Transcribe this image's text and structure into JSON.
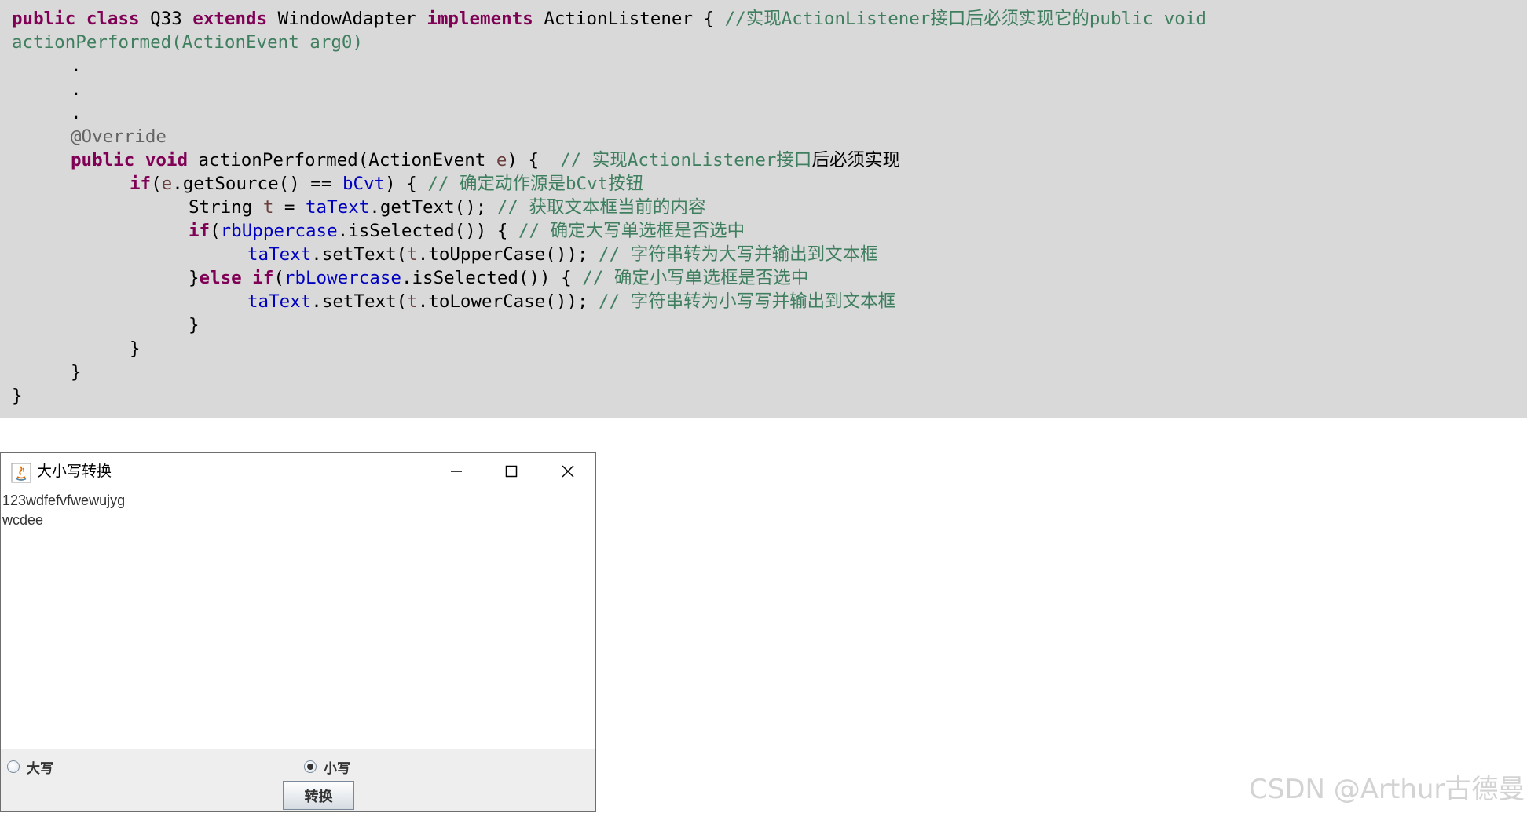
{
  "code": {
    "l1": {
      "kw1": "public class",
      "t1": " Q33 ",
      "kw2": "extends",
      "t2": " WindowAdapter ",
      "kw3": "implements",
      "t3": " ActionListener { ",
      "c": "//实现ActionListener接口后必须实现它的public void"
    },
    "l2": {
      "c": "actionPerformed(ActionEvent arg0)"
    },
    "l3": {
      "t": "."
    },
    "l4": {
      "t": "."
    },
    "l5": {
      "t": "."
    },
    "l6": {
      "ann": "@Override"
    },
    "l7": {
      "kw": "public void",
      "t1": " actionPerformed(ActionEvent ",
      "v": "e",
      "t2": ") {  ",
      "c": "// 实现ActionListener接口",
      "t3": "后必须实现"
    },
    "l8": {
      "kw": "if",
      "t1": "(",
      "v": "e",
      "t2": ".getSource() == ",
      "f": "bCvt",
      "t3": ") { ",
      "c": "// 确定动作源是bCvt按钮"
    },
    "l9": {
      "t1": "String ",
      "v": "t",
      "t2": " = ",
      "f": "taText",
      "t3": ".getText(); ",
      "c": "// 获取文本框当前的内容"
    },
    "l10": {
      "kw": "if",
      "t1": "(",
      "f": "rbUppercase",
      "t2": ".isSelected()) { ",
      "c": "// 确定大写单选框是否选中"
    },
    "l11": {
      "f": "taText",
      "t1": ".setText(",
      "v": "t",
      "t2": ".toUpperCase()); ",
      "c": "// 字符串转为大写并输出到文本框"
    },
    "l12": {
      "t1": "}",
      "kw": "else if",
      "t2": "(",
      "f": "rbLowercase",
      "t3": ".isSelected()) { ",
      "c": "// 确定小写单选框是否选中"
    },
    "l13": {
      "f": "taText",
      "t1": ".setText(",
      "v": "t",
      "t2": ".toLowerCase()); ",
      "c": "// 字符串转为小写写并输出到文本框"
    },
    "l14": {
      "t": "}"
    },
    "l15": {
      "t": "}"
    },
    "l16": {
      "t": "}"
    },
    "l17": {
      "t": "}"
    }
  },
  "window": {
    "title": "大小写转换",
    "icon": "java-icon",
    "text_lines": [
      "123wdfefvfwewujyg",
      "wcdee"
    ],
    "radio_upper_label": "大写",
    "radio_lower_label": "小写",
    "selected_radio": "小写",
    "convert_label": "转换"
  },
  "watermark": "CSDN @Arthur古德曼"
}
